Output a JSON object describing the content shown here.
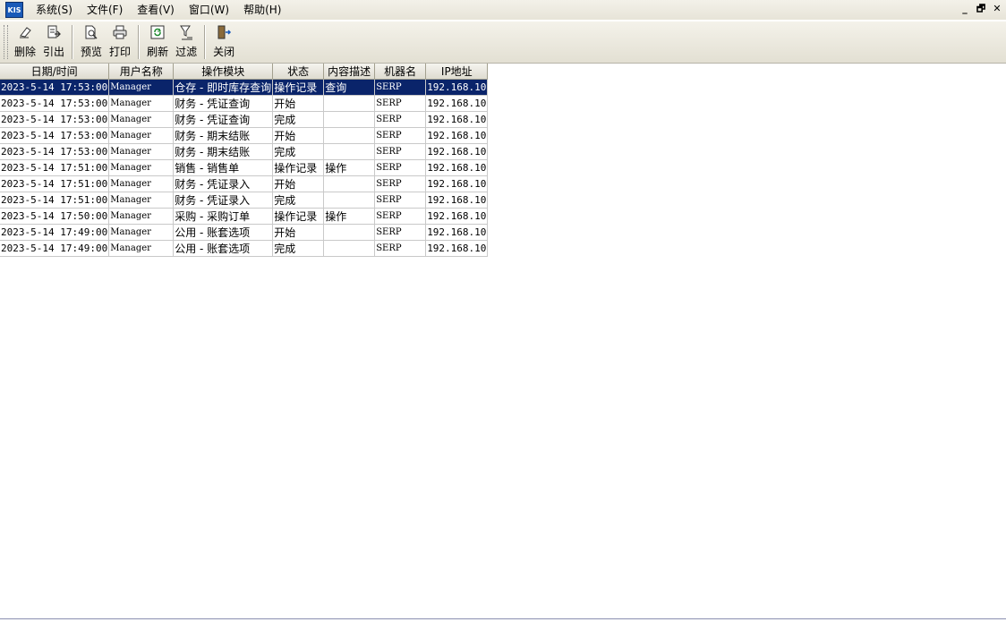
{
  "menu": {
    "logo_text": "KIS",
    "items": [
      "系统(S)",
      "文件(F)",
      "查看(V)",
      "窗口(W)",
      "帮助(H)"
    ],
    "window_controls": [
      "_",
      "🗗",
      "✕"
    ]
  },
  "toolbar": {
    "delete": "删除",
    "export": "引出",
    "preview": "预览",
    "print": "打印",
    "refresh": "刷新",
    "filter": "过滤",
    "close": "关闭"
  },
  "table": {
    "columns": [
      "日期/时间",
      "用户名称",
      "操作模块",
      "状态",
      "内容描述",
      "机器名",
      "IP地址"
    ],
    "rows": [
      [
        "2023-5-14 17:53:00",
        "Manager",
        "仓存 - 即时库存查询",
        "操作记录",
        "查询",
        "SERP",
        "192.168.10"
      ],
      [
        "2023-5-14 17:53:00",
        "Manager",
        "财务 - 凭证查询",
        "开始",
        "",
        "SERP",
        "192.168.10"
      ],
      [
        "2023-5-14 17:53:00",
        "Manager",
        "财务 - 凭证查询",
        "完成",
        "",
        "SERP",
        "192.168.10"
      ],
      [
        "2023-5-14 17:53:00",
        "Manager",
        "财务 - 期末结账",
        "开始",
        "",
        "SERP",
        "192.168.10"
      ],
      [
        "2023-5-14 17:53:00",
        "Manager",
        "财务 - 期末结账",
        "完成",
        "",
        "SERP",
        "192.168.10"
      ],
      [
        "2023-5-14 17:51:00",
        "Manager",
        "销售 - 销售单",
        "操作记录",
        "操作",
        "SERP",
        "192.168.10"
      ],
      [
        "2023-5-14 17:51:00",
        "Manager",
        "财务 - 凭证录入",
        "开始",
        "",
        "SERP",
        "192.168.10"
      ],
      [
        "2023-5-14 17:51:00",
        "Manager",
        "财务 - 凭证录入",
        "完成",
        "",
        "SERP",
        "192.168.10"
      ],
      [
        "2023-5-14 17:50:00",
        "Manager",
        "采购 - 采购订单",
        "操作记录",
        "操作",
        "SERP",
        "192.168.10"
      ],
      [
        "2023-5-14 17:49:00",
        "Manager",
        "公用 - 账套选项",
        "开始",
        "",
        "SERP",
        "192.168.10"
      ],
      [
        "2023-5-14 17:49:00",
        "Manager",
        "公用 - 账套选项",
        "完成",
        "",
        "SERP",
        "192.168.10"
      ]
    ],
    "selected_row": 0
  },
  "colors": {
    "selection": "#0a246a"
  }
}
